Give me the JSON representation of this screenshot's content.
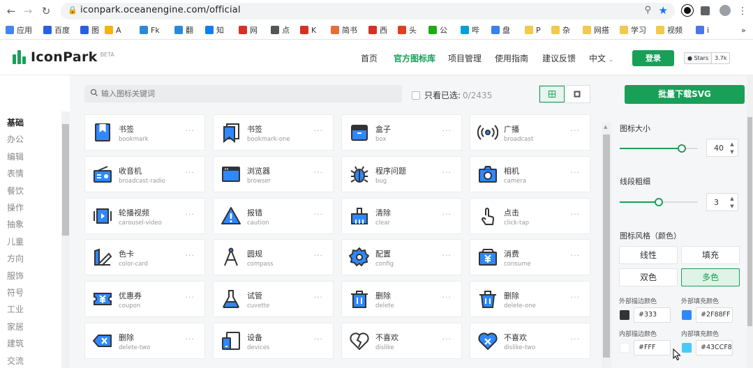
{
  "browser": {
    "url": "iconpark.oceanengine.com/official",
    "bookmarks": [
      "应用",
      "百度",
      "图",
      "A",
      "Fk",
      "翻",
      "知",
      "网",
      "点",
      "K",
      "简书",
      "西",
      "头",
      "公",
      "哔",
      "盘",
      "P",
      "杂",
      "网搭",
      "学习",
      "视频",
      "i"
    ],
    "more": "»"
  },
  "header": {
    "logo_text": "IconPark",
    "beta": "BETA",
    "nav": [
      "首页",
      "官方图标库",
      "项目管理",
      "使用指南",
      "建议反馈",
      "中文"
    ],
    "login": "登录",
    "stars_label": "Stars",
    "stars_count": "3.7k"
  },
  "search": {
    "placeholder": "输入图标关键词",
    "only_selected": "只看已选:",
    "selected_count": "0/2435"
  },
  "categories": [
    "基础",
    "办公",
    "编辑",
    "表情",
    "餐饮",
    "操作",
    "抽象",
    "儿童",
    "方向",
    "服饰",
    "符号",
    "工业",
    "家居",
    "建筑",
    "交流"
  ],
  "icons": [
    {
      "zh": "书签",
      "en": "bookmark",
      "icon": "bookmark-icon"
    },
    {
      "zh": "书签",
      "en": "bookmark-one",
      "icon": "bookmark-one-icon"
    },
    {
      "zh": "盒子",
      "en": "box",
      "icon": "box-icon"
    },
    {
      "zh": "广播",
      "en": "broadcast",
      "icon": "broadcast-icon"
    },
    {
      "zh": "收音机",
      "en": "broadcast-radio",
      "icon": "radio-icon"
    },
    {
      "zh": "浏览器",
      "en": "browser",
      "icon": "browser-icon"
    },
    {
      "zh": "程序问题",
      "en": "bug",
      "icon": "bug-icon"
    },
    {
      "zh": "相机",
      "en": "camera",
      "icon": "camera-icon"
    },
    {
      "zh": "轮播视频",
      "en": "carousel-video",
      "icon": "carousel-video-icon"
    },
    {
      "zh": "报错",
      "en": "caution",
      "icon": "caution-icon"
    },
    {
      "zh": "清除",
      "en": "clear",
      "icon": "clear-icon"
    },
    {
      "zh": "点击",
      "en": "click-tap",
      "icon": "click-tap-icon"
    },
    {
      "zh": "色卡",
      "en": "color-card",
      "icon": "color-card-icon"
    },
    {
      "zh": "圆规",
      "en": "compass",
      "icon": "compass-icon"
    },
    {
      "zh": "配置",
      "en": "config",
      "icon": "config-icon"
    },
    {
      "zh": "消费",
      "en": "consume",
      "icon": "consume-icon"
    },
    {
      "zh": "优惠券",
      "en": "coupon",
      "icon": "coupon-icon"
    },
    {
      "zh": "试管",
      "en": "cuvette",
      "icon": "cuvette-icon"
    },
    {
      "zh": "删除",
      "en": "delete",
      "icon": "delete-icon"
    },
    {
      "zh": "删除",
      "en": "delete-one",
      "icon": "delete-one-icon"
    },
    {
      "zh": "删除",
      "en": "delete-two",
      "icon": "delete-two-icon"
    },
    {
      "zh": "设备",
      "en": "devices",
      "icon": "devices-icon"
    },
    {
      "zh": "不喜欢",
      "en": "dislike",
      "icon": "dislike-icon"
    },
    {
      "zh": "不喜欢",
      "en": "dislike-two",
      "icon": "dislike-two-icon"
    }
  ],
  "more_label": "···",
  "panel": {
    "download": "批量下载SVG",
    "size_label": "图标大小",
    "size_value": "40",
    "stroke_label": "线段粗细",
    "stroke_value": "3",
    "style_label": "图标风格（颜色）",
    "styles": [
      "线性",
      "填充",
      "双色",
      "多色"
    ],
    "outer_stroke_label": "外部描边颜色",
    "outer_fill_label": "外部填充颜色",
    "inner_stroke_label": "内部描边颜色",
    "inner_fill_label": "内部填充颜色",
    "outer_stroke": "#333",
    "outer_fill": "#2F88FF",
    "inner_stroke": "#FFF",
    "inner_fill": "#43CCF8"
  },
  "colors": {
    "accent": "#18a058",
    "blue": "#2F88FF",
    "dark": "#333333",
    "light_blue": "#43CCF8"
  }
}
